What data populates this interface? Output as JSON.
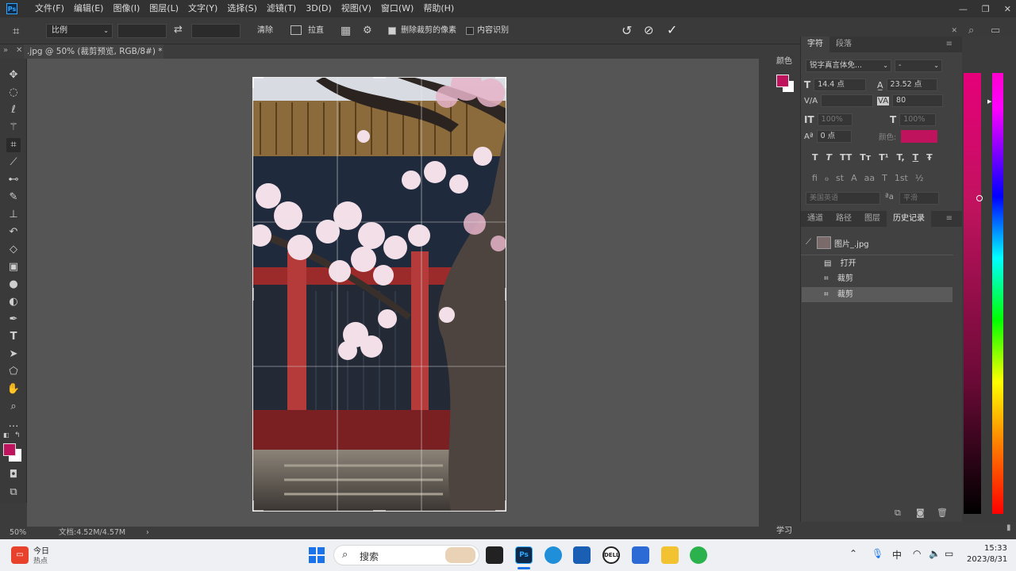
{
  "app": {
    "logo": "Ps",
    "menus": [
      "文件(F)",
      "编辑(E)",
      "图像(I)",
      "图层(L)",
      "文字(Y)",
      "选择(S)",
      "滤镜(T)",
      "3D(D)",
      "视图(V)",
      "窗口(W)",
      "帮助(H)"
    ]
  },
  "options": {
    "ratio_label": "比例",
    "clear_label": "清除",
    "straighten_label": "拉直",
    "delete_pixels_label": "删除裁剪的像素",
    "delete_pixels_checked": true,
    "content_aware_label": "内容识别",
    "content_aware_checked": false
  },
  "document": {
    "tab_title": ".jpg @ 50% (裁剪预览, RGB/8#) *",
    "zoom": "50%",
    "doc_size": "文档:4.52M/4.57M"
  },
  "character_panel": {
    "tabs": [
      "字符",
      "段落"
    ],
    "font_family": "锐字真言体免...",
    "font_style": "-",
    "font_size": "14.4 点",
    "leading": "23.52 点",
    "tracking": "80",
    "vertical_scale": "100%",
    "horizontal_scale": "100%",
    "baseline_shift": "0 点",
    "color_label": "颜色:",
    "text_color": "#c0135e",
    "language": "美国英语",
    "antialias": "平滑",
    "style_buttons": [
      "T",
      "T",
      "TT",
      "Tт",
      "T¹",
      "T,",
      "T",
      "Ŧ"
    ],
    "opentype_buttons": [
      "fi",
      "ℴ",
      "st",
      "A",
      "aa",
      "T",
      "1st",
      "½"
    ]
  },
  "color_panel_label": "颜色",
  "history_panel": {
    "tabs": [
      "通道",
      "路径",
      "图层",
      "历史记录"
    ],
    "snapshot": "图片_.jpg",
    "items": [
      {
        "label": "打开",
        "icon": "document-icon"
      },
      {
        "label": "裁剪",
        "icon": "crop-icon"
      },
      {
        "label": "裁剪",
        "icon": "crop-icon",
        "selected": true
      }
    ]
  },
  "learn_label": "学习",
  "foreground_color": "#c0135e",
  "taskbar": {
    "weather_title": "今日",
    "weather_sub": "热点",
    "search_placeholder": "搜索",
    "ime": "中",
    "time": "15:33",
    "date": "2023/8/31"
  }
}
